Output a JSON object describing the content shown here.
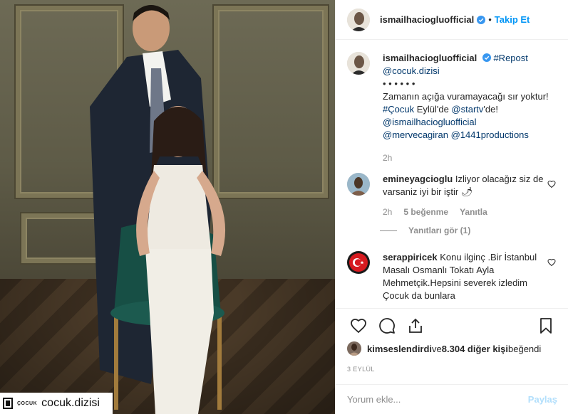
{
  "photo": {
    "repost_tag_small": "ÇOCUK",
    "repost_tag_handle": "cocuk.dizisi"
  },
  "header": {
    "username": "ismailhacioglu official",
    "username_text": "ismailhaciogluofficial",
    "separator": "•",
    "follow_label": "Takip Et"
  },
  "caption": {
    "username": "ismailhaciogluofficial",
    "repost_tag": "#Repost",
    "mention_source": "@cocuk.dizisi",
    "dots": "• • • • • •",
    "text_1": "Zamanın açığa vuramayacağı sır yoktur! ",
    "hashtag": "#Çocuk",
    "text_2": " Eylül'de ",
    "mention_channel": "@startv",
    "text_3": "'de!",
    "mention_1": "@ismailhaciogluofficial",
    "mention_2": "@mervecagiran",
    "mention_3": "@1441productions",
    "time": "2h"
  },
  "comments": [
    {
      "username": "emineyagcioglu",
      "text": "Izliyor olacağız siz de varsaniz iyi bir iştir 🌶",
      "time": "2h",
      "likes": "5 beğenme",
      "reply_label": "Yanıtla",
      "view_replies": "Yanıtları gör (1)"
    },
    {
      "username": "serappiricek",
      "text": "Konu ilginç .Bir İstanbul Masalı Osmanlı Tokatı Ayla Mehmetçik.Hepsini severek izledim Çocuk da bunlara"
    }
  ],
  "likes": {
    "liker": "kimseslendirdi",
    "connector": " ve ",
    "others": "8.304 diğer kişi",
    "suffix": " beğendi"
  },
  "date": "3 EYLÜL",
  "add_comment": {
    "placeholder": "Yorum ekle...",
    "post_label": "Paylaş"
  },
  "icons": {
    "verified": "verified-badge-icon",
    "like": "heart-icon",
    "comment": "comment-icon",
    "share": "share-icon",
    "save": "bookmark-icon",
    "repost": "repost-logo-icon"
  },
  "colors": {
    "accent": "#0095f6",
    "link": "#00376b",
    "muted": "#8e8e8e",
    "post_disabled": "#b2dffc"
  }
}
